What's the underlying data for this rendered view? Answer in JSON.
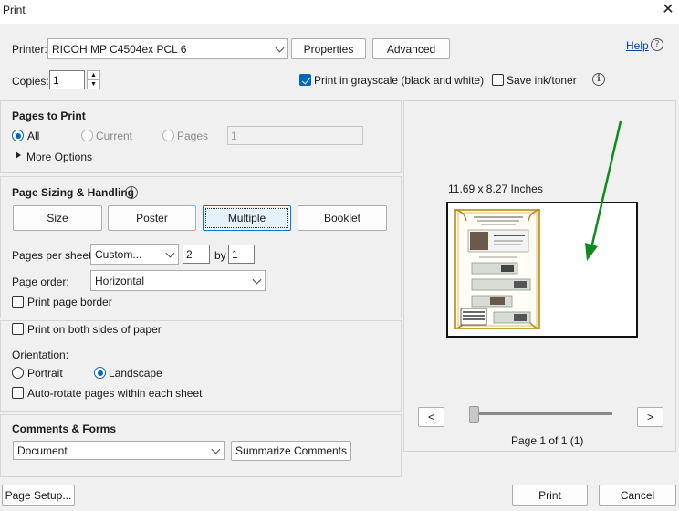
{
  "window": {
    "title": "Print"
  },
  "header": {
    "printer_label": "Printer:",
    "printer_value": "RICOH MP C4504ex PCL 6",
    "properties_label": "Properties",
    "advanced_label": "Advanced",
    "help_label": "Help",
    "copies_label": "Copies:",
    "copies_value": "1",
    "grayscale_label": "Print in grayscale (black and white)",
    "grayscale_checked": true,
    "save_ink_label": "Save ink/toner",
    "save_ink_checked": false
  },
  "pages_to_print": {
    "title": "Pages to Print",
    "all_label": "All",
    "current_label": "Current",
    "pages_label": "Pages",
    "pages_value": "1",
    "more_options_label": "More Options"
  },
  "sizing": {
    "title": "Page Sizing & Handling",
    "tabs": [
      "Size",
      "Poster",
      "Multiple",
      "Booklet"
    ],
    "selected_tab": "Multiple",
    "pages_per_sheet_label": "Pages per sheet:",
    "pages_per_sheet_value": "Custom...",
    "cols_value": "2",
    "by_label": "by",
    "rows_value": "1",
    "page_order_label": "Page order:",
    "page_order_value": "Horizontal",
    "border_label": "Print page border"
  },
  "duplex": {
    "both_sides_label": "Print on both sides of paper",
    "orientation_label": "Orientation:",
    "portrait_label": "Portrait",
    "landscape_label": "Landscape",
    "auto_rotate_label": "Auto-rotate pages within each sheet"
  },
  "comments": {
    "title": "Comments & Forms",
    "value": "Document",
    "summarize_label": "Summarize Comments"
  },
  "preview": {
    "size_label": "11.69 x 8.27 Inches",
    "page_label": "Page 1 of 1 (1)",
    "prev_label": "<",
    "next_label": ">"
  },
  "footer": {
    "page_setup_label": "Page Setup...",
    "print_label": "Print",
    "cancel_label": "Cancel"
  },
  "colors": {
    "accent": "#0067c0",
    "arrow": "#118a1d",
    "gold": "#c8a03c"
  }
}
